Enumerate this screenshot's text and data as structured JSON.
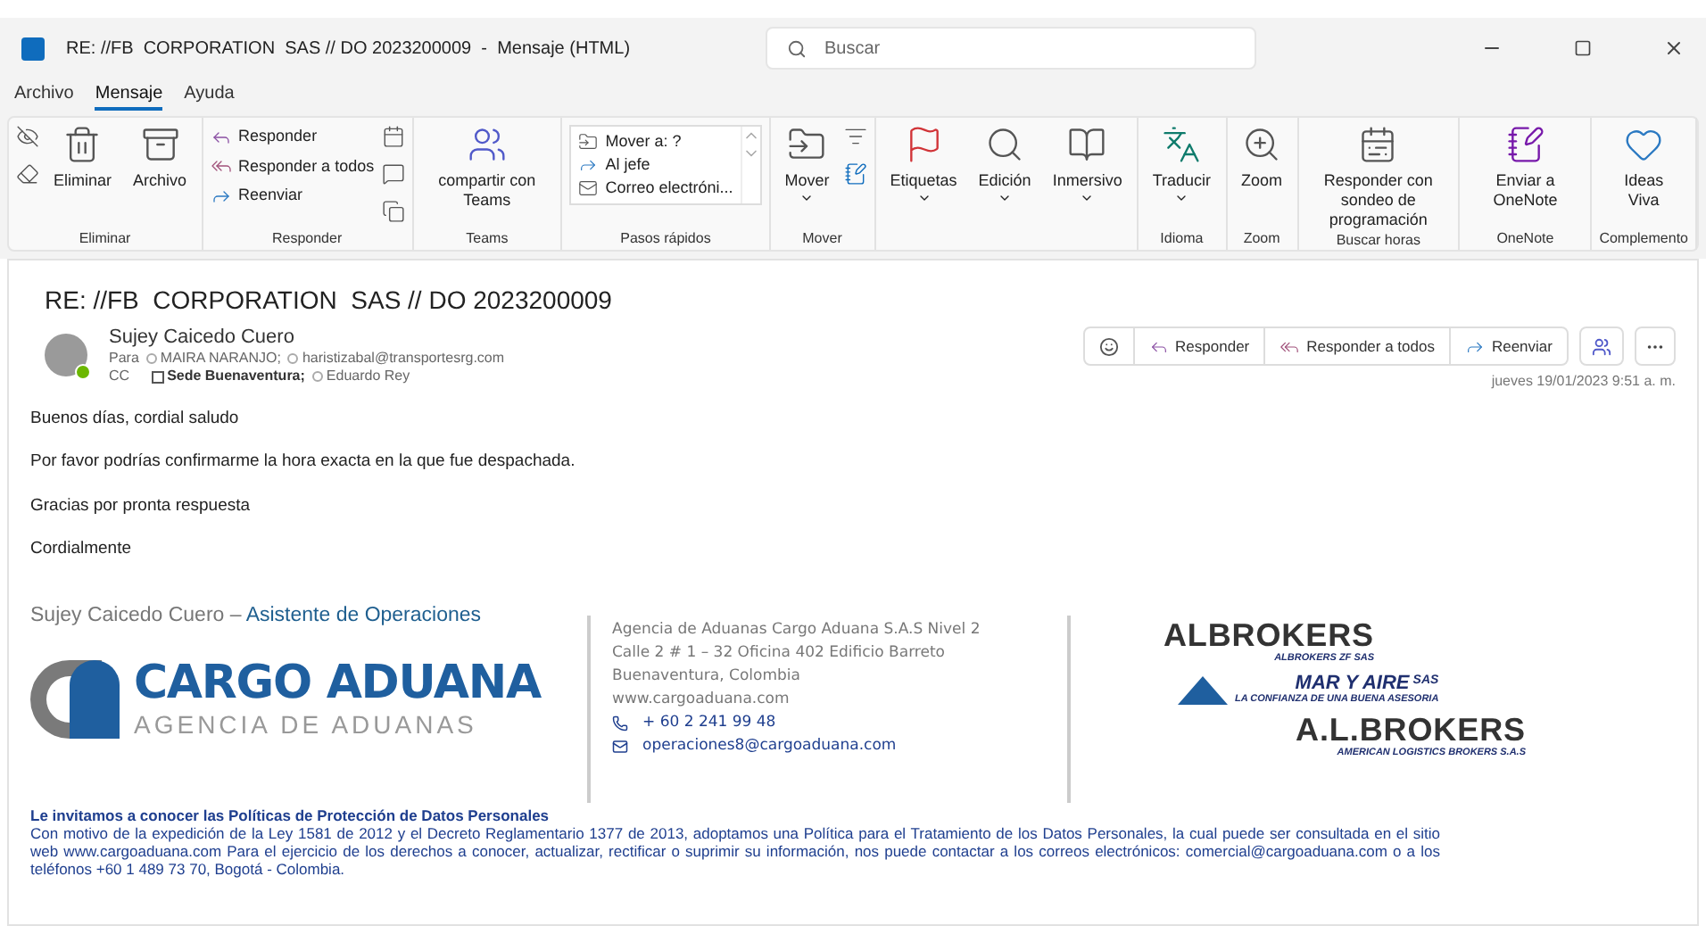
{
  "window": {
    "title": "RE: //FB  CORPORATION  SAS // DO 2023200009  -  Mensaje (HTML)",
    "search_placeholder": "Buscar"
  },
  "menu": [
    {
      "label": "Archivo",
      "selected": false
    },
    {
      "label": "Mensaje",
      "selected": true
    },
    {
      "label": "Ayuda",
      "selected": false
    }
  ],
  "ribbon": [
    {
      "label": "Eliminar",
      "items": [
        {
          "kind": "large",
          "label": "Eliminar",
          "dropdown": false
        },
        {
          "kind": "large",
          "label": "Archivo",
          "dropdown": false
        }
      ]
    },
    {
      "label": "Responder",
      "items": [
        {
          "kind": "list",
          "entries": [
            "Responder",
            "Responder a todos",
            "Reenviar"
          ]
        }
      ]
    },
    {
      "label": "Teams",
      "items": [
        {
          "kind": "large",
          "label": "compartir con Teams",
          "dropdown": false
        }
      ]
    },
    {
      "label": "Pasos rápidos",
      "items": [
        {
          "kind": "gallery",
          "entries": [
            "Mover a: ?",
            "Al jefe",
            "Correo electróni..."
          ]
        }
      ]
    },
    {
      "label": "Mover",
      "items": [
        {
          "kind": "large",
          "label": "Mover",
          "dropdown": true
        }
      ]
    },
    {
      "items": [
        {
          "kind": "large",
          "label": "Etiquetas",
          "dropdown": true
        },
        {
          "kind": "large",
          "label": "Edición",
          "dropdown": true
        },
        {
          "kind": "large",
          "label": "Inmersivo",
          "dropdown": true
        }
      ]
    },
    {
      "label": "Idioma",
      "items": [
        {
          "kind": "large",
          "label": "Traducir",
          "dropdown": true
        }
      ]
    },
    {
      "label": "Zoom",
      "items": [
        {
          "kind": "large",
          "label": "Zoom",
          "dropdown": false
        }
      ]
    },
    {
      "label": "Buscar horas",
      "items": [
        {
          "kind": "large",
          "label": "Responder con sondeo de programación",
          "dropdown": false
        }
      ]
    },
    {
      "label": "OneNote",
      "items": [
        {
          "kind": "large",
          "label": "Enviar a OneNote",
          "dropdown": false
        }
      ]
    },
    {
      "label": "Complemento",
      "items": [
        {
          "kind": "large",
          "label": "Ideas Viva",
          "dropdown": false
        }
      ]
    }
  ],
  "message": {
    "subject": "RE: //FB  CORPORATION  SAS // DO 2023200009",
    "sender": "Sujey Caicedo Cuero",
    "online": true,
    "to_label": "Para",
    "to": [
      "MAIRA NARANJO;",
      "haristizabal@transportesrg.com"
    ],
    "cc_label": "CC",
    "cc": [
      {
        "label": "Sede Buenaventura;",
        "kind": "group"
      },
      {
        "label": "Eduardo Rey",
        "kind": "person"
      }
    ],
    "actions": [
      "Responder",
      "Responder a todos",
      "Reenviar"
    ],
    "date": "jueves 19/01/2023 9:51 a. m.",
    "body": [
      "Buenos días, cordial saludo",
      "Por favor podrías confirmarme la hora exacta en la que fue despachada.",
      "Gracias por pronta respuesta",
      "Cordialmente"
    ]
  },
  "signature": {
    "name": "Sujey Caicedo Cuero",
    "dash": " – ",
    "role": "Asistente de Operaciones",
    "logo_main": "CARGO ADUANA",
    "logo_sub": "AGENCIA DE ADUANAS",
    "address": [
      "Agencia de Aduanas Cargo Aduana S.A.S Nivel 2",
      "Calle 2 # 1 – 32 Oficina 402 Edificio Barreto",
      "Buenaventura, Colombia",
      "www.cargoaduana.com"
    ],
    "phone": "+ 60 2 241 99 48",
    "email": "operaciones8@cargoaduana.com",
    "partners": [
      {
        "name": "ALBROKERS",
        "tagline": "ALBROKERS ZF SAS"
      },
      {
        "name": "MAR Y AIRE",
        "suffix": "SAS",
        "tagline": "LA CONFIANZA DE UNA BUENA ASESORIA"
      },
      {
        "name": "A.L.BROKERS",
        "tagline": "AMERICAN LOGISTICS BROKERS S.A.S"
      }
    ]
  },
  "privacy": {
    "title": "Le invitamos a conocer las Políticas de Protección de Datos Personales",
    "text": "Con motivo de la expedición de la Ley 1581 de 2012 y el Decreto Reglamentario 1377 de 2013, adoptamos una Política para el Tratamiento de los Datos Personales, la cual puede ser consultada en el sitio web www.cargoaduana.com Para el ejercicio de los derechos a conocer, actualizar, rectificar o suprimir su información, nos puede contactar a los correos electrónicos: comercial@cargoaduana.com o a los teléfonos +60 1 489 73 70, Bogotá - Colombia."
  }
}
